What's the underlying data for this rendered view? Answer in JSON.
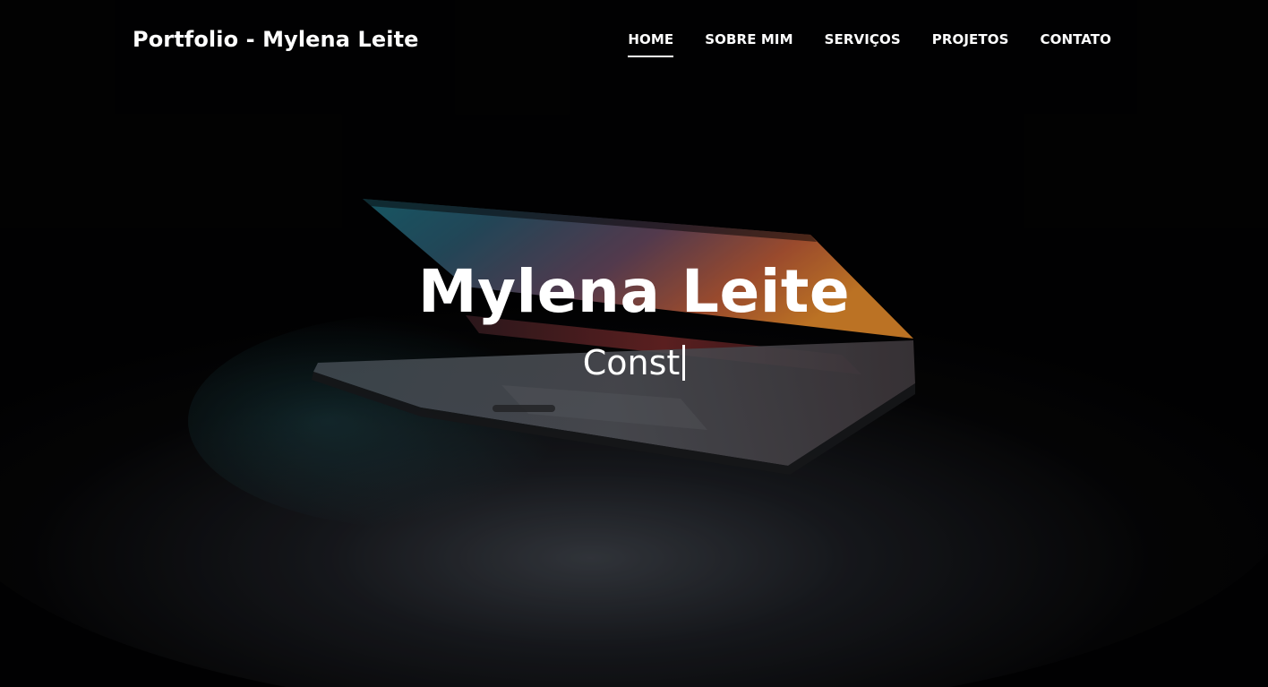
{
  "header": {
    "brand": "Portfolio - Mylena Leite",
    "nav": [
      {
        "label": "HOME",
        "active": true
      },
      {
        "label": "SOBRE MIM",
        "active": false
      },
      {
        "label": "SERVIÇOS",
        "active": false
      },
      {
        "label": "PROJETOS",
        "active": false
      },
      {
        "label": "CONTATO",
        "active": false
      }
    ]
  },
  "hero": {
    "title": "Mylena Leite",
    "typed_text": "Const",
    "background_image": "laptop-dark-icon"
  },
  "colors": {
    "text": "#ffffff",
    "background": "#020203"
  }
}
